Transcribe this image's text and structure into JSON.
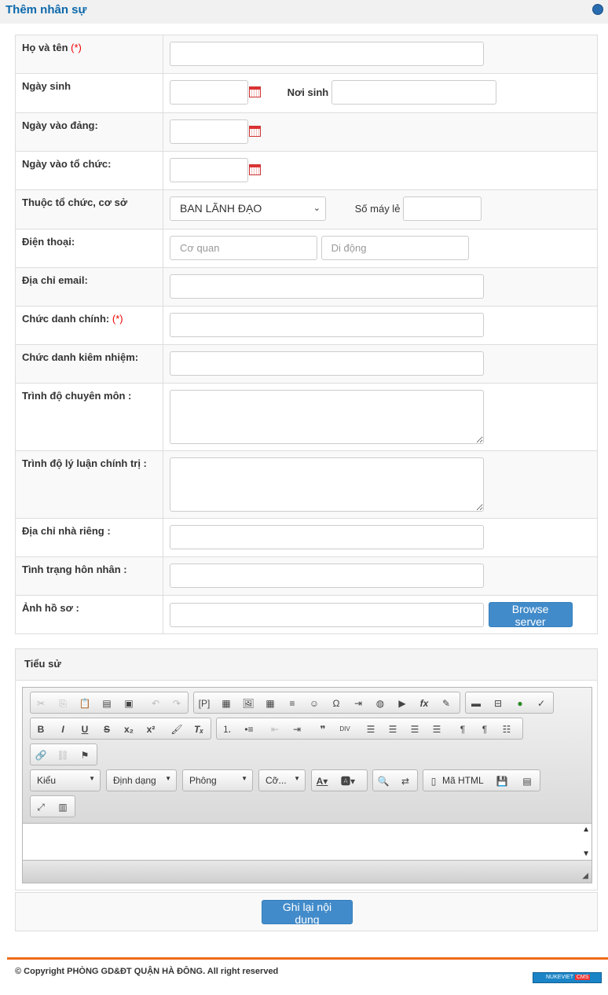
{
  "header": {
    "title": "Thêm nhân sự",
    "icon": "globe-icon"
  },
  "form": {
    "required_mark": "(*)",
    "full_name_label": "Họ và tên",
    "dob_label": "Ngày sinh",
    "birthplace_label": "Nơi sinh",
    "party_date_label": "Ngày vào đảng:",
    "org_date_label": "Ngày vào tổ chức:",
    "org_label": "Thuộc tổ chức, cơ sở",
    "org_selected": "BAN LÃNH ĐẠO",
    "ext_label": "Số máy lẻ",
    "phone_label": "Điện thoại:",
    "phone_office_placeholder": "Cơ quan",
    "phone_mobile_placeholder": "Di động",
    "email_label": "Địa chỉ email:",
    "title_label": "Chức danh chính:",
    "concurrent_label": "Chức danh kiêm nhiệm:",
    "expertise_label": "Trình độ chuyên môn :",
    "political_label": "Trình độ lý luận chính trị :",
    "address_label": "Địa chỉ nhà riêng :",
    "marital_label": "Tình trạng hôn nhân :",
    "photo_label": "Ảnh hồ sơ :",
    "browse_label": "Browse server"
  },
  "bio": {
    "title": "Tiểu sử",
    "combo_style": "Kiểu",
    "combo_format": "Định dạng",
    "combo_font": "Phông",
    "combo_size": "Cỡ...",
    "source_label": "Mã HTML"
  },
  "submit_label": "Ghi lại nội dung",
  "footer": {
    "copyright": "© Copyright PHÒNG GD&ĐT QUẬN HÀ ĐÔNG. All right reserved",
    "logo_text": "NUKEVIET",
    "logo_badge": "CMS"
  },
  "colors": {
    "title": "#0b68ab",
    "accent": "#428bca",
    "footer_line": "#ef6b1a"
  }
}
